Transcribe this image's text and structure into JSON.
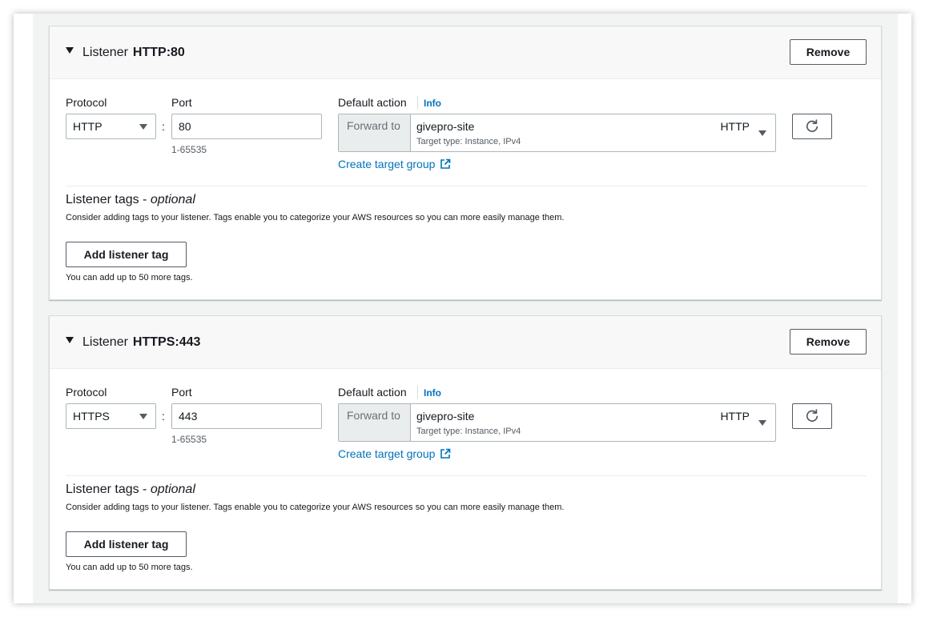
{
  "listeners": [
    {
      "label": "Listener",
      "value": "HTTP:80",
      "remove_label": "Remove",
      "protocol_label": "Protocol",
      "protocol_value": "HTTP",
      "port_label": "Port",
      "colon": ":",
      "port_value": "80",
      "port_hint": "1-65535",
      "default_action_label": "Default action",
      "info_label": "Info",
      "forward_label": "Forward to",
      "target_group_name": "givepro-site",
      "target_group_type": "Target type: Instance, IPv4",
      "target_group_protocol": "HTTP",
      "create_target_group_label": "Create target group",
      "tags_title": "Listener tags - ",
      "tags_optional": "optional",
      "tags_description": "Consider adding tags to your listener. Tags enable you to categorize your AWS resources so you can more easily manage them.",
      "add_tag_label": "Add listener tag",
      "tags_limit": "You can add up to 50 more tags."
    },
    {
      "label": "Listener",
      "value": "HTTPS:443",
      "remove_label": "Remove",
      "protocol_label": "Protocol",
      "protocol_value": "HTTPS",
      "port_label": "Port",
      "colon": ":",
      "port_value": "443",
      "port_hint": "1-65535",
      "default_action_label": "Default action",
      "info_label": "Info",
      "forward_label": "Forward to",
      "target_group_name": "givepro-site",
      "target_group_type": "Target type: Instance, IPv4",
      "target_group_protocol": "HTTP",
      "create_target_group_label": "Create target group",
      "tags_title": "Listener tags - ",
      "tags_optional": "optional",
      "tags_description": "Consider adding tags to your listener. Tags enable you to categorize your AWS resources so you can more easily manage them.",
      "add_tag_label": "Add listener tag",
      "tags_limit": "You can add up to 50 more tags."
    }
  ],
  "colors": {
    "link": "#0073bb",
    "border": "#aab7b8",
    "button_border": "#545b64",
    "header_bg": "#f8f8f8",
    "forward_bg": "#eaeded"
  },
  "icons": {
    "caret": "caret-down-icon",
    "dropdown": "dropdown-triangle-icon",
    "refresh": "refresh-icon",
    "external": "external-link-icon"
  }
}
